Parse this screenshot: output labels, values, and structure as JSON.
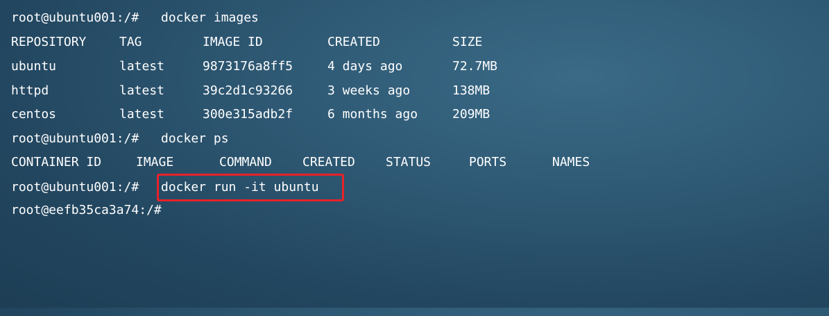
{
  "terminal": {
    "prompt_host": "root@ubuntu001:/#",
    "prompt_container": "root@eefb35ca3a74:/#",
    "cmd_images": "docker images",
    "cmd_ps": "docker ps",
    "cmd_run": "docker run -it ubuntu",
    "images_table": {
      "headers": [
        "REPOSITORY",
        "TAG",
        "IMAGE ID",
        "CREATED",
        "SIZE"
      ],
      "rows": [
        [
          "ubuntu",
          "latest",
          "9873176a8ff5",
          "4 days ago",
          "72.7MB"
        ],
        [
          "httpd",
          "latest",
          "39c2d1c93266",
          "3 weeks ago",
          "138MB"
        ],
        [
          "centos",
          "latest",
          "300e315adb2f",
          "6 months ago",
          "209MB"
        ]
      ]
    },
    "ps_table": {
      "headers": [
        "CONTAINER ID",
        "IMAGE",
        "COMMAND",
        "CREATED",
        "STATUS",
        "PORTS",
        "NAMES"
      ]
    },
    "highlight_color": "#e8212a",
    "background_color": "#2f5a75"
  }
}
